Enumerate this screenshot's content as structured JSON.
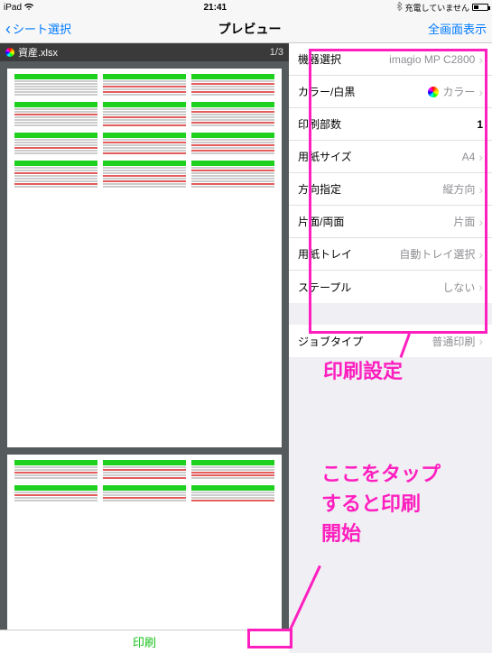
{
  "status": {
    "device": "iPad",
    "time": "21:41",
    "charging_text": "充電していません"
  },
  "nav": {
    "back_label": "シート選択",
    "title": "プレビュー",
    "right_label": "全画面表示"
  },
  "preview": {
    "filename": "資産.xlsx",
    "page_indicator": "1/3",
    "print_label": "印刷"
  },
  "settings": {
    "rows": [
      {
        "label": "機器選択",
        "value": "imagio MP C2800",
        "chevron": true
      },
      {
        "label": "カラー/白黒",
        "value": "カラー",
        "chevron": true,
        "color_ball": true
      },
      {
        "label": "印刷部数",
        "value": "1",
        "chevron": false,
        "bold_value": true
      },
      {
        "label": "用紙サイズ",
        "value": "A4",
        "chevron": true
      },
      {
        "label": "方向指定",
        "value": "縦方向",
        "chevron": true
      },
      {
        "label": "片面/両面",
        "value": "片面",
        "chevron": true
      },
      {
        "label": "用紙トレイ",
        "value": "自動トレイ選択",
        "chevron": true
      },
      {
        "label": "ステープル",
        "value": "しない",
        "chevron": true
      }
    ],
    "job_row": {
      "label": "ジョブタイプ",
      "value": "普通印刷",
      "chevron": true
    }
  },
  "annotations": {
    "settings_label": "印刷設定",
    "tap_label_l1": "ここをタップ",
    "tap_label_l2": "すると印刷",
    "tap_label_l3": "開始"
  }
}
